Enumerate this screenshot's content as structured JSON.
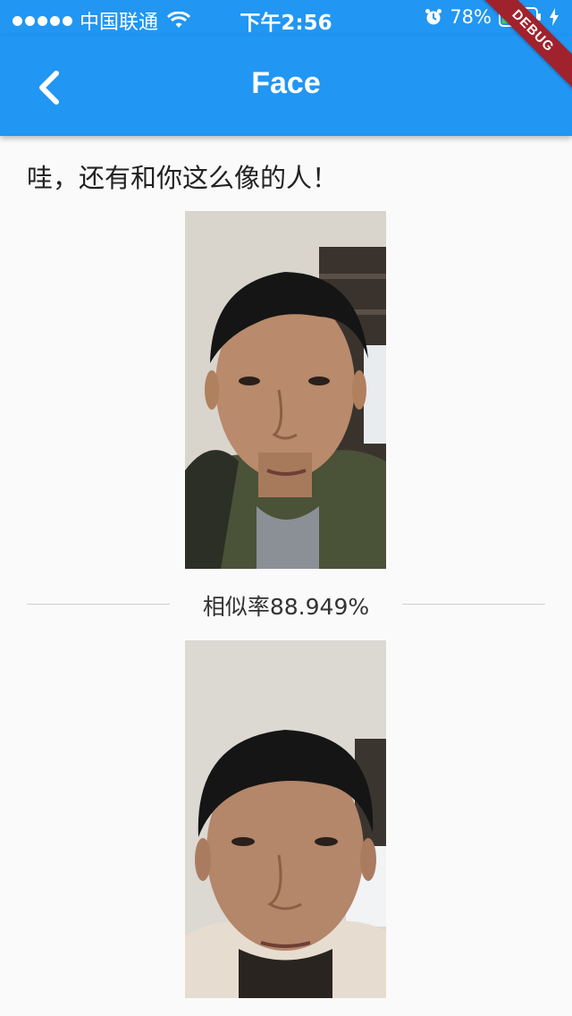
{
  "status_bar": {
    "carrier": "中国联通",
    "time": "下午2:56",
    "battery": "78%"
  },
  "app_bar": {
    "title": "Face",
    "debug_label": "DEBUG"
  },
  "content": {
    "headline": "哇，还有和你这么像的人！",
    "similarity_label": "相似率88.949%"
  },
  "colors": {
    "primary": "#2196f3",
    "background": "#fafafa",
    "debug_banner": "#a0222c"
  },
  "icons": {
    "back": "chevron-left-icon",
    "wifi": "wifi-icon",
    "alarm": "alarm-icon",
    "battery": "battery-icon",
    "charging": "charging-icon"
  }
}
